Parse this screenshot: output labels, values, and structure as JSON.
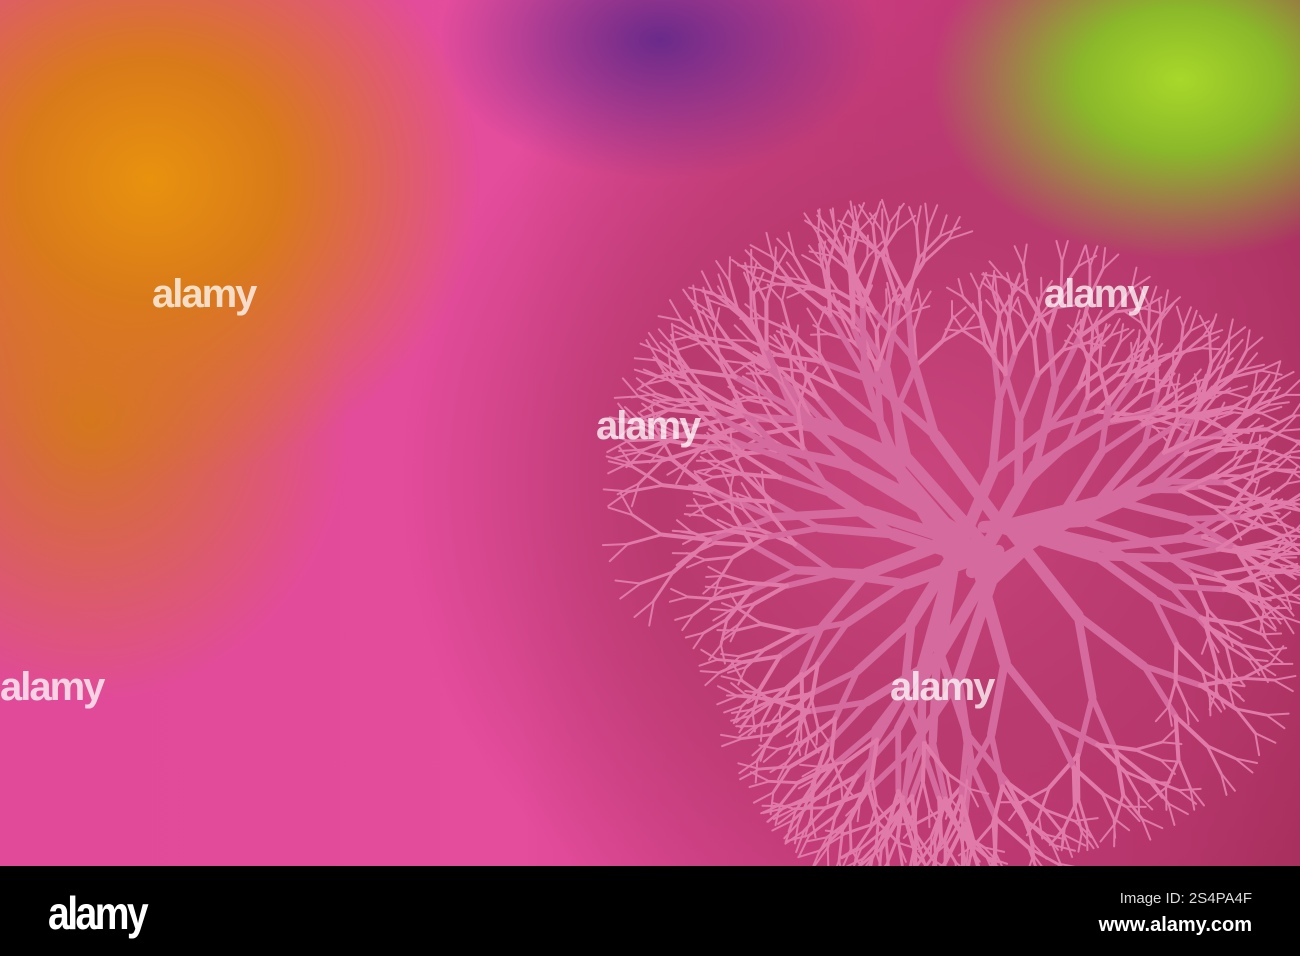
{
  "watermark": "alamy",
  "footer": {
    "logo": "alamy",
    "image_id": "Image ID: 2S4PA4F",
    "url": "www.alamy.com"
  },
  "colors": {
    "orange": "#e8920e",
    "magenta": "#e04a98",
    "coral": "#c9457d",
    "green": "#a8d82a"
  }
}
